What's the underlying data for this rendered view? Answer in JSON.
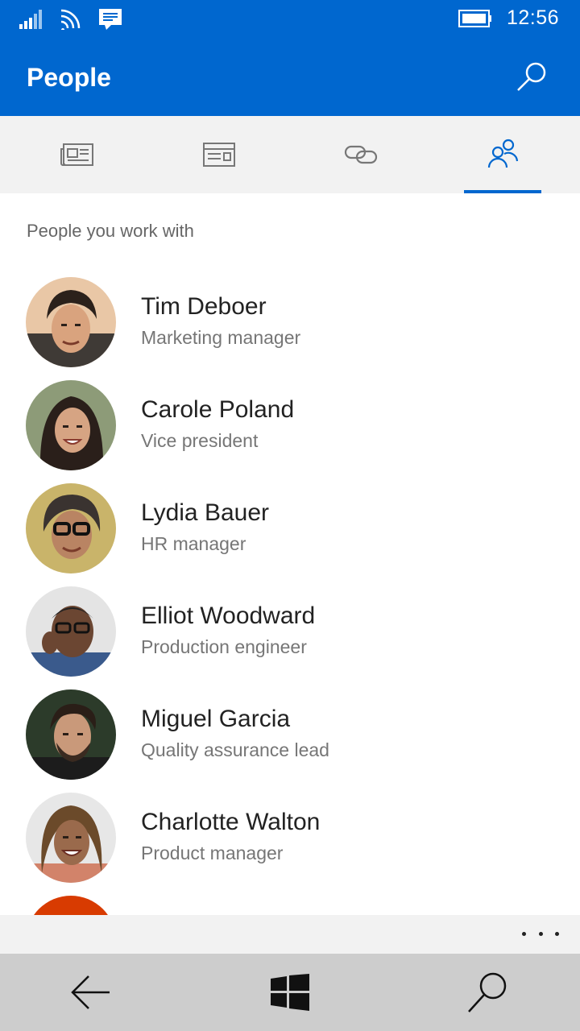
{
  "status_bar": {
    "time": "12:56",
    "icons": [
      "signal-icon",
      "wifi-icon",
      "message-icon",
      "battery-icon"
    ]
  },
  "header": {
    "title": "People",
    "search_icon": "search-icon"
  },
  "tabs": [
    {
      "icon": "news-icon",
      "active": false
    },
    {
      "icon": "documents-icon",
      "active": false
    },
    {
      "icon": "link-icon",
      "active": false
    },
    {
      "icon": "people-icon",
      "active": true
    }
  ],
  "section": {
    "heading": "People you work with"
  },
  "people": [
    {
      "name": "Tim Deboer",
      "title": "Marketing manager"
    },
    {
      "name": "Carole Poland",
      "title": "Vice president"
    },
    {
      "name": "Lydia Bauer",
      "title": "HR manager"
    },
    {
      "name": "Elliot Woodward",
      "title": "Production engineer"
    },
    {
      "name": "Miguel Garcia",
      "title": "Quality assurance lead"
    },
    {
      "name": "Charlotte Walton",
      "title": "Product manager"
    }
  ],
  "appbar": {
    "more_icon": "more-icon"
  },
  "navbar": {
    "icons": [
      "back-icon",
      "windows-icon",
      "search-icon"
    ]
  },
  "colors": {
    "accent": "#0067cf",
    "tabbar_bg": "#f2f2f2",
    "navbar_bg": "#cdcdcd",
    "partial_avatar": "#d83b01"
  }
}
